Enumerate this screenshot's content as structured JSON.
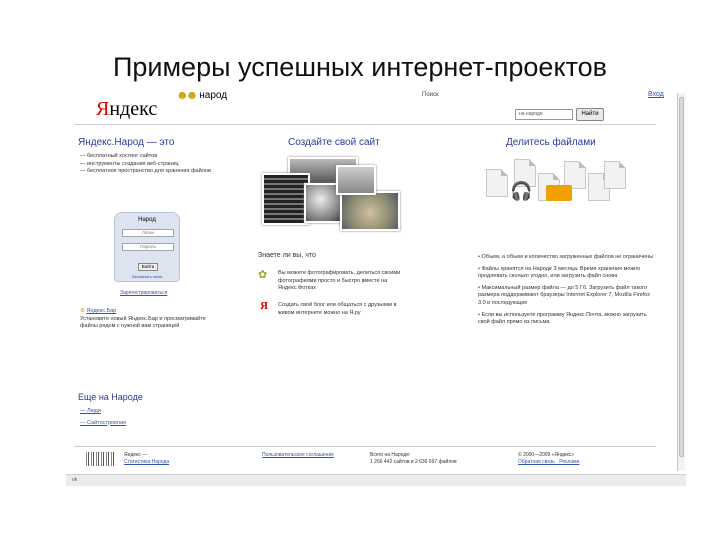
{
  "slide": {
    "title": "Примеры успешных интернет-проектов"
  },
  "header": {
    "logo_y": "Я",
    "logo_rest": "ндекс",
    "service_name": "народ",
    "search_scope": "Поиск",
    "search_placeholder": "на народе",
    "search_button": "Найти",
    "enter_link": "Вход"
  },
  "left": {
    "about_title": "Яндекс.Народ — это",
    "about_items": [
      "— бесплатный хостинг сайтов",
      "— инструменты создания веб-страниц",
      "— бесплатное пространство для хранения файлов"
    ],
    "login": {
      "title": "Народ",
      "login_placeholder": "Логин",
      "password_placeholder": "Пароль",
      "button": "Войти",
      "remember": "Запомнить меня",
      "register": "Зарегистрироваться"
    },
    "update_title": "Яндекс.Бар",
    "update_text": "Установите новый Яндекс.Бар и просматривайте файлы рядом с нужной вам страницей",
    "more_title": "Еще на Народе",
    "more_items": [
      "— Люди",
      "— Сайтостроение"
    ]
  },
  "middle": {
    "create_title": "Создайте свой сайт",
    "did_you_know": "Знаете ли вы, что",
    "fact1": "Вы можете фотографировать, делиться своими фотографиями просто и быстро вместе на Яндекс.Фотках",
    "fact2": "Создать свой блог или общаться с друзьями в живом интернете можно на Я.ру"
  },
  "right": {
    "share_title": "Делитесь файлами",
    "items": [
      "Объем, а объем и количество загруженных файлов не ограничены",
      "Файлы хранятся на Народе 3 месяца. Время хранения можно продлевать сколько угодно, или загрузить файл снова",
      "Максимальный размер файла — до 5 Гб. Загрузить файл такого размера поддерживают браузеры Internet Explorer 7, Mozilla Firefox 3.0 и последующие",
      "Если вы используете программу Яндекс.Почта, можно загрузить свой файл прямо из письма"
    ]
  },
  "footer": {
    "col1": [
      "Яндекс —",
      "Статистика Народа"
    ],
    "col2": "Пользовательское соглашение",
    "col3": [
      "Всего на Народе:",
      "1 266 442 сайтов и 2 636 697 файлов"
    ],
    "col4": [
      "© 2000—2009 «Яндекс»",
      "Обратная связь · Реклама"
    ]
  },
  "status_text": "ok"
}
